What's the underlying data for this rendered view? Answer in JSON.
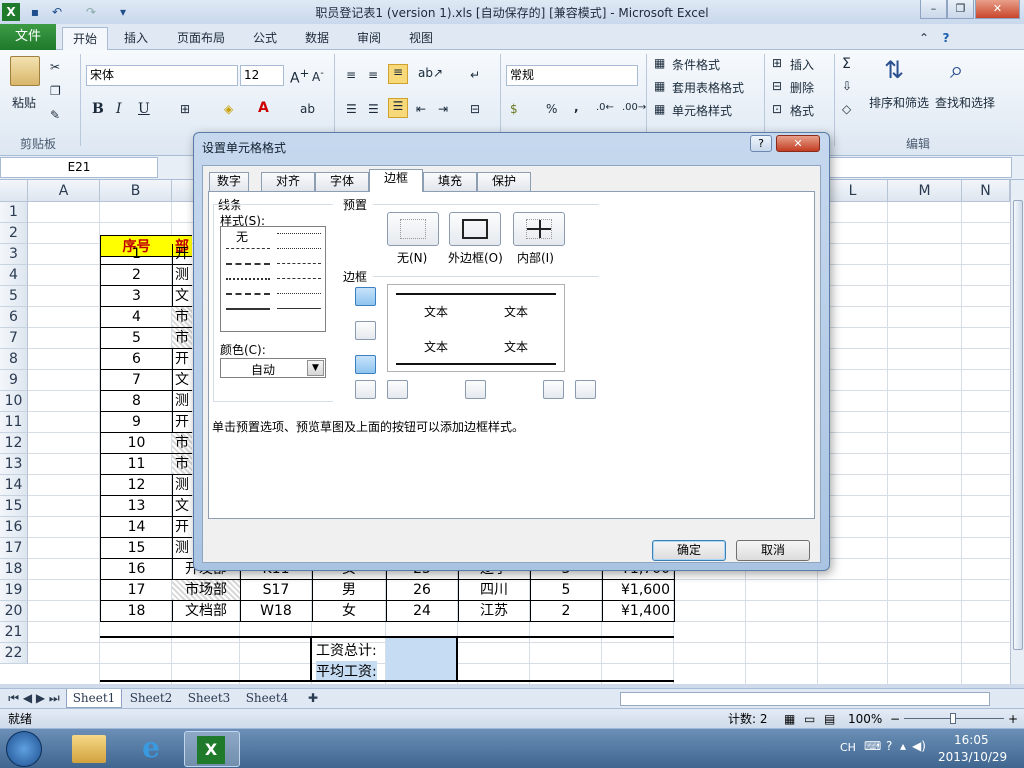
{
  "window": {
    "title": "职员登记表1 (version 1).xls [自动保存的] [兼容模式] - Microsoft Excel",
    "minimize": "–",
    "restore": "❐",
    "close": "✕"
  },
  "ribbon": {
    "file_tab": "文件",
    "tabs": [
      "开始",
      "插入",
      "页面布局",
      "公式",
      "数据",
      "审阅",
      "视图"
    ],
    "active_tab": "开始",
    "clipboard": {
      "paste": "粘贴",
      "group": "剪贴板"
    },
    "font": {
      "name": "宋体",
      "size": "12",
      "bold": "B",
      "italic": "I",
      "underline": "U"
    },
    "number": {
      "format": "常规",
      "percent": "%",
      "comma": ","
    },
    "styles": {
      "conditional": "条件格式",
      "table": "套用表格格式",
      "cell": "单元格样式"
    },
    "cells": {
      "insert": "插入",
      "delete": "删除",
      "format": "格式"
    },
    "editing": {
      "sort": "排序和筛选",
      "find": "查找和选择",
      "group": "编辑"
    }
  },
  "formula_bar": {
    "name_box": "E21"
  },
  "sheet": {
    "columns": [
      "A",
      "B",
      "L",
      "M",
      "N"
    ],
    "rows": [
      "1",
      "2",
      "3",
      "4",
      "5",
      "6",
      "7",
      "8",
      "9",
      "10",
      "11",
      "12",
      "13",
      "14",
      "15",
      "16",
      "17",
      "18",
      "19",
      "20",
      "21",
      "22"
    ],
    "header_cell": "序号",
    "header_partial": "部",
    "serials": [
      "1",
      "2",
      "3",
      "4",
      "5",
      "6",
      "7",
      "8",
      "9",
      "10",
      "11",
      "12",
      "13",
      "14",
      "15"
    ],
    "dept_partial": [
      "开",
      "测",
      "文",
      "市",
      "市",
      "开",
      "文",
      "测",
      "开",
      "市",
      "市",
      "测",
      "文",
      "开",
      "测"
    ],
    "visible_rows": [
      {
        "no": "16",
        "dept": "开发部",
        "id": "K11",
        "sex": "女",
        "age": "25",
        "place": "辽宁",
        "years": "3",
        "salary": "¥1,700"
      },
      {
        "no": "17",
        "dept": "市场部",
        "id": "S17",
        "sex": "男",
        "age": "26",
        "place": "四川",
        "years": "5",
        "salary": "¥1,600"
      },
      {
        "no": "18",
        "dept": "文档部",
        "id": "W18",
        "sex": "女",
        "age": "24",
        "place": "江苏",
        "years": "2",
        "salary": "¥1,400"
      }
    ],
    "total_label": "工资总计:",
    "avg_label": "平均工资:",
    "tabs": [
      "Sheet1",
      "Sheet2",
      "Sheet3",
      "Sheet4"
    ]
  },
  "status": {
    "ready": "就绪",
    "count": "计数: 2",
    "zoom": "100%",
    "zoom_minus": "−",
    "zoom_plus": "+"
  },
  "taskbar": {
    "lang": "CH",
    "time": "16:05",
    "date": "2013/10/29"
  },
  "dialog": {
    "title": "设置单元格格式",
    "help": "?",
    "close": "✕",
    "tabs": [
      "数字",
      "对齐",
      "字体",
      "边框",
      "填充",
      "保护"
    ],
    "active_tab": "边框",
    "line_section": "线条",
    "style_label": "样式(S):",
    "style_none": "无",
    "color_label": "颜色(C):",
    "color_value": "自动",
    "preset_section": "预置",
    "presets": [
      "无(N)",
      "外边框(O)",
      "内部(I)"
    ],
    "border_section": "边框",
    "preview_text": "文本",
    "hint": "单击预置选项、预览草图及上面的按钮可以添加边框样式。",
    "ok": "确定",
    "cancel": "取消"
  }
}
